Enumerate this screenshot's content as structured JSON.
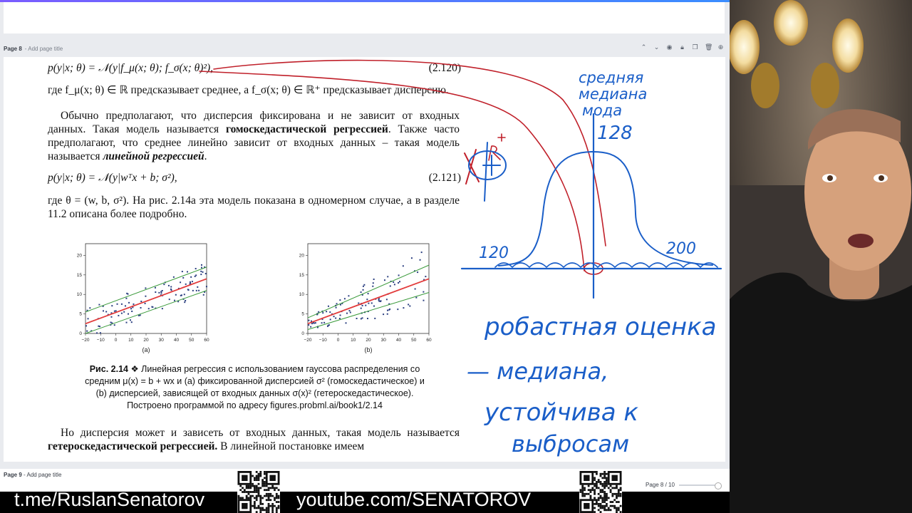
{
  "canvas": {
    "prev_page_label": "Page 8",
    "prev_page_add_title": "- Add page title",
    "next_page_label": "Page 9",
    "next_page_add_title": "- Add page title",
    "pager": "Page 8 / 10",
    "icons": [
      "chevron-up-icon",
      "chevron-down-icon",
      "eye-icon",
      "lock-icon",
      "copy-icon",
      "delete-icon",
      "add-page-icon"
    ]
  },
  "doc": {
    "eq1": "p(y|x; θ) = 𝒩(y|f_μ(x; θ); f_σ(x; θ)²),",
    "eq1_num": "(2.120)",
    "p1": "где f_μ(x; θ) ∈ ℝ предсказывает среднее, а f_σ(x; θ) ∈ ℝ⁺ предсказывает дисперсию.",
    "p2_a": "Обычно предполагают, что дисперсия фиксирована и не зависит от входных данных. Такая модель называется ",
    "p2_b": "гомоскедастической регрессией",
    "p2_c": ". Также часто предполагают, что среднее линейно зависит от входных данных – такая модель называется ",
    "p2_d": "линейной регрессией",
    "p2_e": ".",
    "eq2": "p(y|x; θ) = 𝒩(y|wᵀx + b; σ²),",
    "eq2_num": "(2.121)",
    "p3": "где θ = (w, b, σ²). На рис. 2.14a эта модель показана в одномерном случае, а в разделе 11.2 описана более подробно.",
    "caption_label": "Рис. 2.14",
    "caption_text": "❖  Линейная регрессия с использованием гауссова распределения со средним μ(x) = b + wx и (a) фиксированной дисперсией σ² (гомоскедастическое) и (b) дисперсией, зависящей от входных данных σ(x)² (гетероскедастическое). Построено программой по адресу figures.probml.ai/book1/2.14",
    "p4_a": "Но дисперсия может и зависеть от входных данных, такая модель называется ",
    "p4_b": "гетероскедастической регрессией.",
    "p4_c": " В линейной постановке имеем"
  },
  "chart_data": [
    {
      "type": "scatter",
      "title": "",
      "xlabel": "(a)",
      "ylabel": "",
      "xlim": [
        -20,
        60
      ],
      "ylim": [
        0,
        23
      ],
      "x_ticks": [
        "−20",
        "−10",
        "0",
        "10",
        "20",
        "30",
        "40",
        "50",
        "60"
      ],
      "y_ticks": [
        "0",
        "5",
        "10",
        "15",
        "20"
      ],
      "mean_line": [
        [
          -20,
          2.5
        ],
        [
          60,
          14
        ]
      ],
      "upper_line": [
        [
          -20,
          5.5
        ],
        [
          60,
          17
        ]
      ],
      "lower_line": [
        [
          -20,
          -0.5
        ],
        [
          60,
          11
        ]
      ],
      "colors": {
        "mean": "#e23b3b",
        "band": "#3a9a3a",
        "points": "#2b3f80"
      }
    },
    {
      "type": "scatter",
      "title": "",
      "xlabel": "(b)",
      "ylabel": "",
      "xlim": [
        -20,
        60
      ],
      "ylim": [
        0,
        23
      ],
      "x_ticks": [
        "−20",
        "−10",
        "0",
        "10",
        "20",
        "30",
        "40",
        "50",
        "60"
      ],
      "y_ticks": [
        "0",
        "5",
        "10",
        "15",
        "20"
      ],
      "mean_line": [
        [
          -20,
          2.5
        ],
        [
          60,
          14
        ]
      ],
      "upper_line": [
        [
          -20,
          4
        ],
        [
          60,
          17.5
        ]
      ],
      "lower_line": [
        [
          -20,
          1
        ],
        [
          60,
          10.5
        ]
      ],
      "colors": {
        "mean": "#e23b3b",
        "band": "#3a9a3a",
        "points": "#2b3f80"
      }
    }
  ],
  "handwriting": {
    "top": "средняя медиана мода",
    "x": "128",
    "left": "120",
    "right": "200",
    "rplus": "R⁺",
    "line1": "робастная оценка",
    "line2": "— медиана,",
    "line3": "устойчива к",
    "line4": "выбросам"
  },
  "banner": {
    "telegram": "t.me/RuslanSenatorov",
    "youtube": "youtube.com/SENATOROV"
  }
}
